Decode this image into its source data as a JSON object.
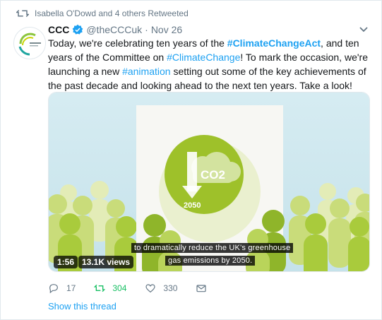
{
  "retweet_context": {
    "text": "Isabella O'Dowd and 4 others Retweeted"
  },
  "tweet": {
    "display_name": "CCC",
    "handle": "@theCCCuk",
    "separator": "·",
    "timestamp": "Nov 26",
    "text_parts": [
      {
        "text": "Today, we're celebrating ten years of the "
      },
      {
        "text": "#ClimateChangeAct"
      },
      {
        "text": ", and ten years of the Committee on "
      },
      {
        "text": "#ClimateChange"
      },
      {
        "text": "! To mark the occasion, we're launching a new "
      },
      {
        "text": "#animation"
      },
      {
        "text": " setting out some of the key achievements of the past decade and looking ahead to the next ten years. Take a look!"
      }
    ]
  },
  "media": {
    "icon_text": "CO2",
    "icon_year": "2050",
    "subtitle_line1": "to dramatically reduce the UK's greenhouse",
    "subtitle_line2": "gas emissions by 2050.",
    "duration": "1:56",
    "views": "13.1K views"
  },
  "actions": {
    "replies": "17",
    "retweets": "304",
    "likes": "330"
  },
  "show_thread": "Show this thread",
  "colors": {
    "link_blue": "#1da1f2",
    "retweet_green": "#17bf63",
    "muted": "#657786",
    "leaf_green": "#9ec12a"
  },
  "icons": [
    "retweet-icon",
    "verified-badge-icon",
    "chevron-down-icon",
    "reply-icon",
    "like-icon",
    "share-icon"
  ]
}
